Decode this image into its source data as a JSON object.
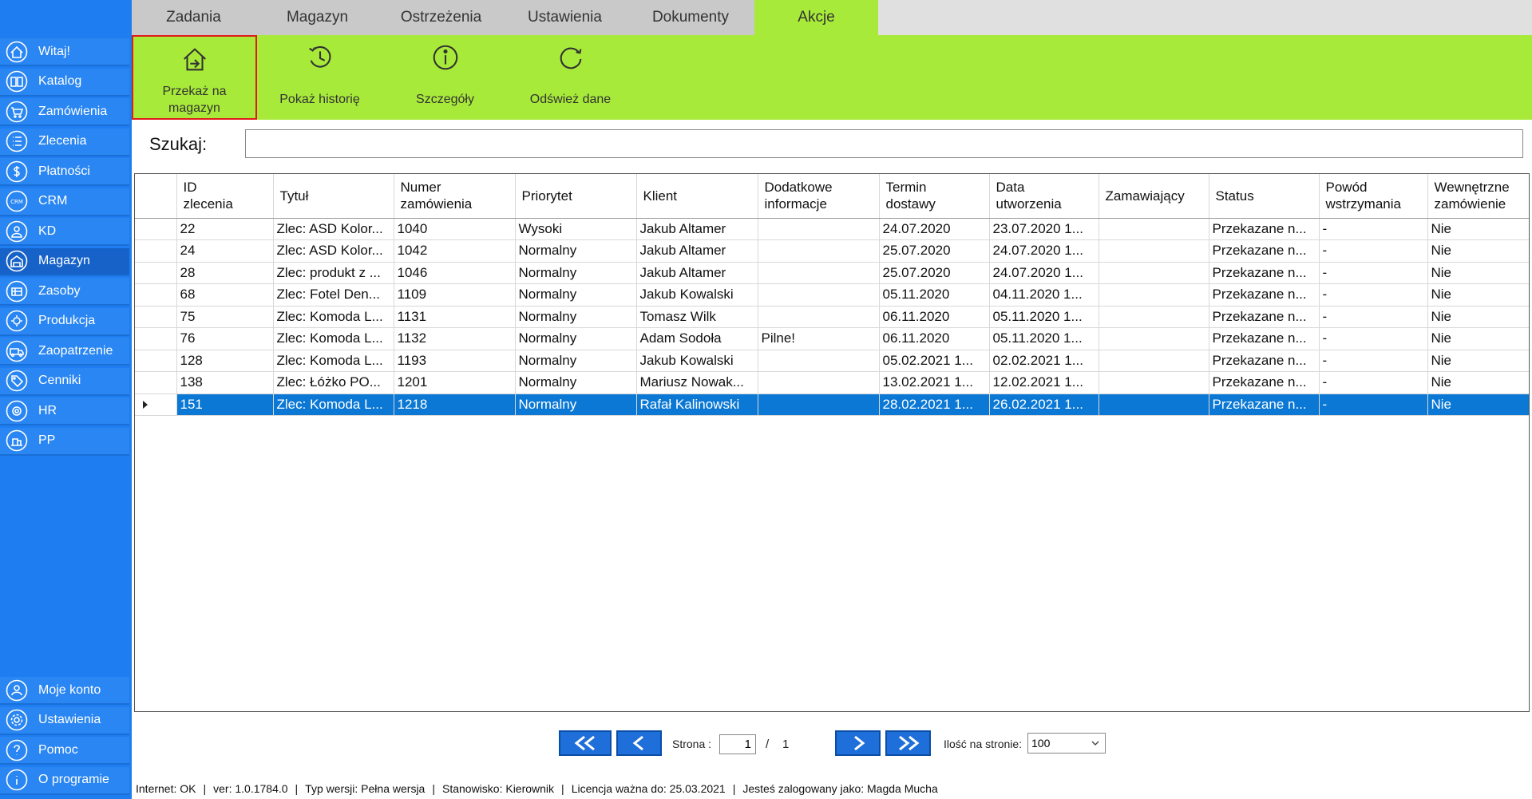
{
  "tabs": [
    {
      "label": "Zadania"
    },
    {
      "label": "Magazyn"
    },
    {
      "label": "Ostrzeżenia"
    },
    {
      "label": "Ustawienia"
    },
    {
      "label": "Dokumenty"
    },
    {
      "label": "Akcje",
      "active": true
    }
  ],
  "ribbon": {
    "buttons": [
      {
        "label_line1": "Przekaż na",
        "label_line2": "magazyn",
        "icon": "home-transfer-icon",
        "selected": true
      },
      {
        "label_line1": "Pokaż historię",
        "label_line2": "",
        "icon": "history-icon"
      },
      {
        "label_line1": "Szczegóły",
        "label_line2": "",
        "icon": "info-icon"
      },
      {
        "label_line1": "Odśwież dane",
        "label_line2": "",
        "icon": "refresh-icon"
      }
    ]
  },
  "sidebar": {
    "items": [
      {
        "label": "Witaj!",
        "icon": "home-icon"
      },
      {
        "label": "Katalog",
        "icon": "book-icon"
      },
      {
        "label": "Zamówienia",
        "icon": "cart-icon"
      },
      {
        "label": "Zlecenia",
        "icon": "list-icon"
      },
      {
        "label": "Płatności",
        "icon": "dollar-icon"
      },
      {
        "label": "CRM",
        "icon": "crm-icon"
      },
      {
        "label": "KD",
        "icon": "person-icon"
      },
      {
        "label": "Magazyn",
        "icon": "warehouse-icon",
        "active": true
      },
      {
        "label": "Zasoby",
        "icon": "resources-icon"
      },
      {
        "label": "Produkcja",
        "icon": "production-icon"
      },
      {
        "label": "Zaopatrzenie",
        "icon": "truck-icon"
      },
      {
        "label": "Cenniki",
        "icon": "tag-icon"
      },
      {
        "label": "HR",
        "icon": "hr-icon"
      },
      {
        "label": "PP",
        "icon": "pp-icon"
      }
    ],
    "bottom_items": [
      {
        "label": "Moje konto",
        "icon": "account-icon"
      },
      {
        "label": "Ustawienia",
        "icon": "gear-icon"
      },
      {
        "label": "Pomoc",
        "icon": "help-icon"
      },
      {
        "label": "O programie",
        "icon": "about-icon"
      }
    ]
  },
  "search": {
    "label": "Szukaj:",
    "value": "",
    "placeholder": ""
  },
  "grid": {
    "columns": [
      {
        "line1": "ID",
        "line2": "zlecenia"
      },
      {
        "line1": "Tytuł",
        "line2": ""
      },
      {
        "line1": "Numer",
        "line2": "zamówienia"
      },
      {
        "line1": "Priorytet",
        "line2": ""
      },
      {
        "line1": "Klient",
        "line2": ""
      },
      {
        "line1": "Dodatkowe",
        "line2": "informacje"
      },
      {
        "line1": "Termin",
        "line2": "dostawy"
      },
      {
        "line1": "Data",
        "line2": "utworzenia"
      },
      {
        "line1": "Zamawiający",
        "line2": ""
      },
      {
        "line1": "Status",
        "line2": ""
      },
      {
        "line1": "Powód",
        "line2": "wstrzymania"
      },
      {
        "line1": "Wewnętrzne",
        "line2": "zamówienie"
      }
    ],
    "rows": [
      [
        "22",
        "Zlec: ASD Kolor...",
        "1040",
        "Wysoki",
        "Jakub  Altamer",
        "",
        "24.07.2020",
        "23.07.2020 1...",
        "",
        "Przekazane n...",
        "-",
        "Nie"
      ],
      [
        "24",
        "Zlec: ASD Kolor...",
        "1042",
        "Normalny",
        "Jakub  Altamer",
        "",
        "25.07.2020",
        "24.07.2020 1...",
        "",
        "Przekazane n...",
        "-",
        "Nie"
      ],
      [
        "28",
        "Zlec: produkt z ...",
        "1046",
        "Normalny",
        "Jakub  Altamer",
        "",
        "25.07.2020",
        "24.07.2020 1...",
        "",
        "Przekazane n...",
        "-",
        "Nie"
      ],
      [
        "68",
        "Zlec: Fotel Den...",
        "1109",
        "Normalny",
        "Jakub Kowalski",
        "",
        "05.11.2020",
        "04.11.2020 1...",
        "",
        "Przekazane n...",
        "-",
        "Nie"
      ],
      [
        "75",
        "Zlec: Komoda L...",
        "1131",
        "Normalny",
        "Tomasz Wilk",
        "",
        "06.11.2020",
        "05.11.2020 1...",
        "",
        "Przekazane n...",
        "-",
        "Nie"
      ],
      [
        "76",
        "Zlec: Komoda L...",
        "1132",
        "Normalny",
        "Adam Sodoła",
        "Pilne!",
        "06.11.2020",
        "05.11.2020 1...",
        "",
        "Przekazane n...",
        "-",
        "Nie"
      ],
      [
        "128",
        "Zlec: Komoda L...",
        "1193",
        "Normalny",
        "Jakub Kowalski",
        "",
        "05.02.2021 1...",
        "02.02.2021 1...",
        "",
        "Przekazane n...",
        "-",
        "Nie"
      ],
      [
        "138",
        "Zlec: Łóżko PO...",
        "1201",
        "Normalny",
        "Mariusz Nowak...",
        "",
        "13.02.2021 1...",
        "12.02.2021 1...",
        "",
        "Przekazane n...",
        "-",
        "Nie"
      ],
      [
        "151",
        "Zlec: Komoda L...",
        "1218",
        "Normalny",
        "Rafał  Kalinowski",
        "",
        "28.02.2021 1...",
        "26.02.2021 1...",
        "",
        "Przekazane n...",
        "-",
        "Nie"
      ]
    ],
    "selected_row": 8
  },
  "pager": {
    "page_label": "Strona :",
    "current_page": "1",
    "separator": "/",
    "total_pages": "1",
    "per_page_label": "Ilość na stronie:",
    "per_page_value": "100"
  },
  "statusbar": {
    "internet": "Internet: OK",
    "version": "ver: 1.0.1784.0",
    "version_type": "Typ wersji: Pełna wersja",
    "position": "Stanowisko: Kierownik",
    "license": "Licencja ważna do: 25.03.2021",
    "user": "Jesteś zalogowany jako: Magda Mucha"
  },
  "colors": {
    "sidebar": "#1e7df0",
    "ribbon": "#a8ea3a",
    "selection": "#0a78d4",
    "pager_button": "#1e6fd9"
  }
}
